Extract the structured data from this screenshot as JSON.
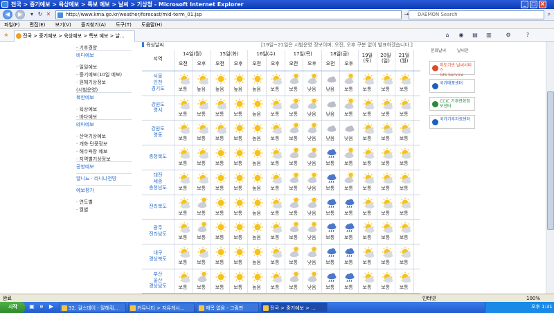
{
  "window": {
    "title": "전국 > 중기예보 > 육상예보 > 특보 예보 > 날씨 > 기상청 - Microsoft Internet Explorer",
    "min": "_",
    "max": "□",
    "close": "X"
  },
  "address": {
    "url": "http://www.kma.go.kr/weather/forecast/mid-term_01.jsp",
    "search_placeholder": "DAEMON Search"
  },
  "menu": [
    "파일(F)",
    "편집(E)",
    "보기(V)",
    "즐겨찾기(A)",
    "도구(T)",
    "도움말(H)"
  ],
  "tab": {
    "label": "전국 > 중기예보 > 육상예보 > 특보 예보 > 날..."
  },
  "sidebar": {
    "items": [
      {
        "text": "· 기후경향",
        "kind": "item"
      },
      {
        "text": "바다예보",
        "kind": "head"
      },
      {
        "text": "· 일일예보",
        "kind": "item"
      },
      {
        "text": "· 중기예보(10일 예보)",
        "kind": "item"
      },
      {
        "text": "· 원해기상정보",
        "kind": "item"
      },
      {
        "text": "(시범운영)",
        "kind": "item"
      },
      {
        "text": "북한예보",
        "kind": "head"
      },
      {
        "text": "· 육상예보",
        "kind": "item"
      },
      {
        "text": "· 바다예보",
        "kind": "item"
      },
      {
        "text": "테마예보",
        "kind": "head"
      },
      {
        "text": "· 산악기상예보",
        "kind": "item"
      },
      {
        "text": "· 개화·단풍정보",
        "kind": "item"
      },
      {
        "text": "· 해수욕장 예보",
        "kind": "item"
      },
      {
        "text": "· 지역별기상정보",
        "kind": "item"
      },
      {
        "text": "공항예보",
        "kind": "head"
      },
      {
        "text": "엘니뇨 · 라니냐전망",
        "kind": "head"
      },
      {
        "text": "예보평가",
        "kind": "head"
      },
      {
        "text": "· 연도별",
        "kind": "item"
      },
      {
        "text": "· 월별",
        "kind": "item"
      }
    ]
  },
  "section": {
    "title": "육상날씨",
    "note": "[19일~21일은 시범운영 정보이며, 오전, 오후 구분 없이 발표하겠습니다.]"
  },
  "table": {
    "region_header": "지역",
    "days": [
      {
        "label": "14일(월)",
        "split": true
      },
      {
        "label": "15일(화)",
        "split": true
      },
      {
        "label": "16일(수)",
        "split": true
      },
      {
        "label": "17일(목)",
        "split": true
      },
      {
        "label": "18일(금)",
        "split": true
      },
      {
        "label": "19일 (토)",
        "split": false
      },
      {
        "label": "20일 (일)",
        "split": false
      },
      {
        "label": "21일 (월)",
        "split": false
      }
    ],
    "am": "오전",
    "pm": "오후",
    "rows": [
      {
        "region": "서울\n인천\n경기도",
        "cells": [
          [
            "ps",
            "보통"
          ],
          [
            "ps",
            "높음"
          ],
          [
            "s",
            "높음"
          ],
          [
            "s",
            "높음"
          ],
          [
            "s",
            "높음"
          ],
          [
            "ps",
            "보통"
          ],
          [
            "pc",
            "보통"
          ],
          [
            "pc",
            "낮음"
          ],
          [
            "c",
            "낮음"
          ],
          [
            "pc",
            "보통"
          ],
          [
            "ps",
            "보통"
          ],
          [
            "ps",
            "보통"
          ],
          [
            "ps",
            "보통"
          ]
        ]
      },
      {
        "region": "강원도\n영서",
        "cells": [
          [
            "ps",
            "보통"
          ],
          [
            "ps",
            "보통"
          ],
          [
            "ps",
            "보통"
          ],
          [
            "s",
            "보통"
          ],
          [
            "s",
            "높음"
          ],
          [
            "ps",
            "보통"
          ],
          [
            "pc",
            "보통"
          ],
          [
            "pc",
            "낮음"
          ],
          [
            "c",
            "낮음"
          ],
          [
            "pc",
            "보통"
          ],
          [
            "ps",
            "보통"
          ],
          [
            "ps",
            "보통"
          ],
          [
            "ps",
            "보통"
          ]
        ]
      },
      {
        "region": "강원도\n영동",
        "cells": [
          [
            "ps",
            "보통"
          ],
          [
            "ps",
            "보통"
          ],
          [
            "ps",
            "보통"
          ],
          [
            "s",
            "보통"
          ],
          [
            "s",
            "높음"
          ],
          [
            "ps",
            "보통"
          ],
          [
            "pc",
            "보통"
          ],
          [
            "pc",
            "낮음"
          ],
          [
            "c",
            "낮음"
          ],
          [
            "c",
            "낮음"
          ],
          [
            "ps",
            "보통"
          ],
          [
            "ps",
            "보통"
          ],
          [
            "ps",
            "보통"
          ]
        ]
      },
      {
        "region": "충청북도",
        "cells": [
          [
            "ps",
            "보통"
          ],
          [
            "ps",
            "보통"
          ],
          [
            "s",
            "보통"
          ],
          [
            "s",
            "보통"
          ],
          [
            "s",
            "높음"
          ],
          [
            "ps",
            "보통"
          ],
          [
            "pc",
            "보통"
          ],
          [
            "pc",
            "낮음"
          ],
          [
            "r",
            "보통"
          ],
          [
            "pc",
            "보통"
          ],
          [
            "ps",
            "보통"
          ],
          [
            "ps",
            "보통"
          ],
          [
            "ps",
            "보통"
          ]
        ]
      },
      {
        "region": "대전\n세종\n충청남도",
        "cells": [
          [
            "ps",
            "보통"
          ],
          [
            "ps",
            "보통"
          ],
          [
            "s",
            "보통"
          ],
          [
            "s",
            "보통"
          ],
          [
            "s",
            "높음"
          ],
          [
            "ps",
            "보통"
          ],
          [
            "pc",
            "보통"
          ],
          [
            "pc",
            "낮음"
          ],
          [
            "r",
            "보통"
          ],
          [
            "pc",
            "보통"
          ],
          [
            "ps",
            "보통"
          ],
          [
            "ps",
            "보통"
          ],
          [
            "ps",
            "보통"
          ]
        ]
      },
      {
        "region": "전라북도",
        "cells": [
          [
            "ps",
            "보통"
          ],
          [
            "pc",
            "보통"
          ],
          [
            "s",
            "보통"
          ],
          [
            "s",
            "보통"
          ],
          [
            "s",
            "높음"
          ],
          [
            "ps",
            "보통"
          ],
          [
            "pc",
            "보통"
          ],
          [
            "pc",
            "낮음"
          ],
          [
            "r",
            "보통"
          ],
          [
            "r",
            "보통"
          ],
          [
            "ps",
            "보통"
          ],
          [
            "ps",
            "보통"
          ],
          [
            "ps",
            "보통"
          ]
        ]
      },
      {
        "region": "광주\n전라남도",
        "cells": [
          [
            "ps",
            "보통"
          ],
          [
            "pc",
            "보통"
          ],
          [
            "s",
            "보통"
          ],
          [
            "s",
            "보통"
          ],
          [
            "s",
            "높음"
          ],
          [
            "ps",
            "보통"
          ],
          [
            "pc",
            "보통"
          ],
          [
            "pc",
            "낮음"
          ],
          [
            "r",
            "보통"
          ],
          [
            "r",
            "보통"
          ],
          [
            "ps",
            "보통"
          ],
          [
            "ps",
            "보통"
          ],
          [
            "ps",
            "보통"
          ]
        ]
      },
      {
        "region": "대구\n경상북도",
        "cells": [
          [
            "ps",
            "보통"
          ],
          [
            "ps",
            "보통"
          ],
          [
            "s",
            "보통"
          ],
          [
            "s",
            "보통"
          ],
          [
            "s",
            "높음"
          ],
          [
            "ps",
            "보통"
          ],
          [
            "pc",
            "보통"
          ],
          [
            "pc",
            "낮음"
          ],
          [
            "r",
            "보통"
          ],
          [
            "r",
            "보통"
          ],
          [
            "ps",
            "보통"
          ],
          [
            "ps",
            "보통"
          ],
          [
            "ps",
            "보통"
          ]
        ]
      },
      {
        "region": "부산\n울산\n경상남도",
        "cells": [
          [
            "ps",
            "보통"
          ],
          [
            "pc",
            "보통"
          ],
          [
            "s",
            "보통"
          ],
          [
            "s",
            "보통"
          ],
          [
            "s",
            "높음"
          ],
          [
            "ps",
            "보통"
          ],
          [
            "pc",
            "보통"
          ],
          [
            "pc",
            "낮음"
          ],
          [
            "r",
            "보통"
          ],
          [
            "r",
            "보통"
          ],
          [
            "ps",
            "보통"
          ],
          [
            "ps",
            "보통"
          ],
          [
            "ps",
            "보통"
          ]
        ]
      }
    ]
  },
  "rightbar": {
    "top_a": "문화날씨",
    "top_b": "날씨안",
    "buttons": [
      {
        "text": "지도기반 날씨서비스\nGIS Service",
        "color": "#e04a2a"
      },
      {
        "text": "국가태풍센터",
        "color": "#1f5fbf"
      },
      {
        "text": "CCIC 기후변화정보센터",
        "color": "#2a8a3a"
      },
      {
        "text": "국가기후자료센터",
        "color": "#1f5fbf"
      }
    ]
  },
  "icons": {
    "s": "sun-icon",
    "ps": "partly-sunny-icon",
    "pc": "cloudy-sun-icon",
    "c": "cloud-icon",
    "r": "rain-icon"
  },
  "status": {
    "left": "완료",
    "zone": "인터넷",
    "zoom": "100%"
  },
  "taskbar": {
    "start": "시작",
    "tasks": [
      "32. 걸스데이 - 말해줘...",
      "커뮤니티 > 자유게시...",
      "제목 없음 - 그림판",
      "전국 > 중기예보 > ..."
    ],
    "clock": "오후 1:31"
  }
}
